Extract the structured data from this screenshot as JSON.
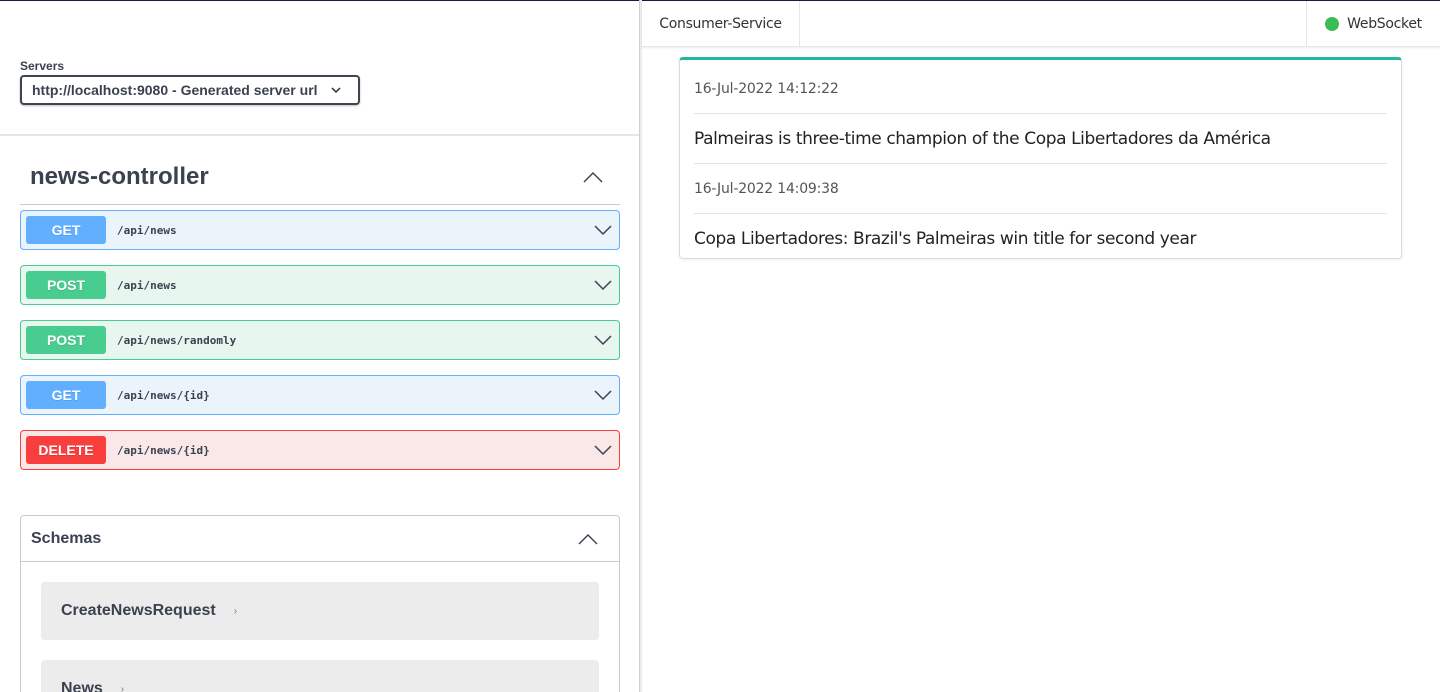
{
  "swagger": {
    "servers_label": "Servers",
    "server_selected": "http://localhost:9080 - Generated server url",
    "tag_title": "news-controller",
    "operations": [
      {
        "method": "GET",
        "path": "/api/news"
      },
      {
        "method": "POST",
        "path": "/api/news"
      },
      {
        "method": "POST",
        "path": "/api/news/randomly"
      },
      {
        "method": "GET",
        "path": "/api/news/{id}"
      },
      {
        "method": "DELETE",
        "path": "/api/news/{id}"
      }
    ],
    "schemas_title": "Schemas",
    "schemas": [
      "CreateNewsRequest",
      "News"
    ]
  },
  "consumer": {
    "app_title": "Consumer-Service",
    "ws_label": "WebSocket",
    "ws_status_color": "#3cba54",
    "news": [
      {
        "date": "16-Jul-2022 14:12:22",
        "title": "Palmeiras is three-time champion of the Copa Libertadores da América"
      },
      {
        "date": "16-Jul-2022 14:09:38",
        "title": "Copa Libertadores: Brazil's Palmeiras win title for second year"
      }
    ]
  },
  "colors": {
    "get": "#61affe",
    "post": "#49cc90",
    "delete": "#f93e3e",
    "accent": "#22b8a0"
  }
}
